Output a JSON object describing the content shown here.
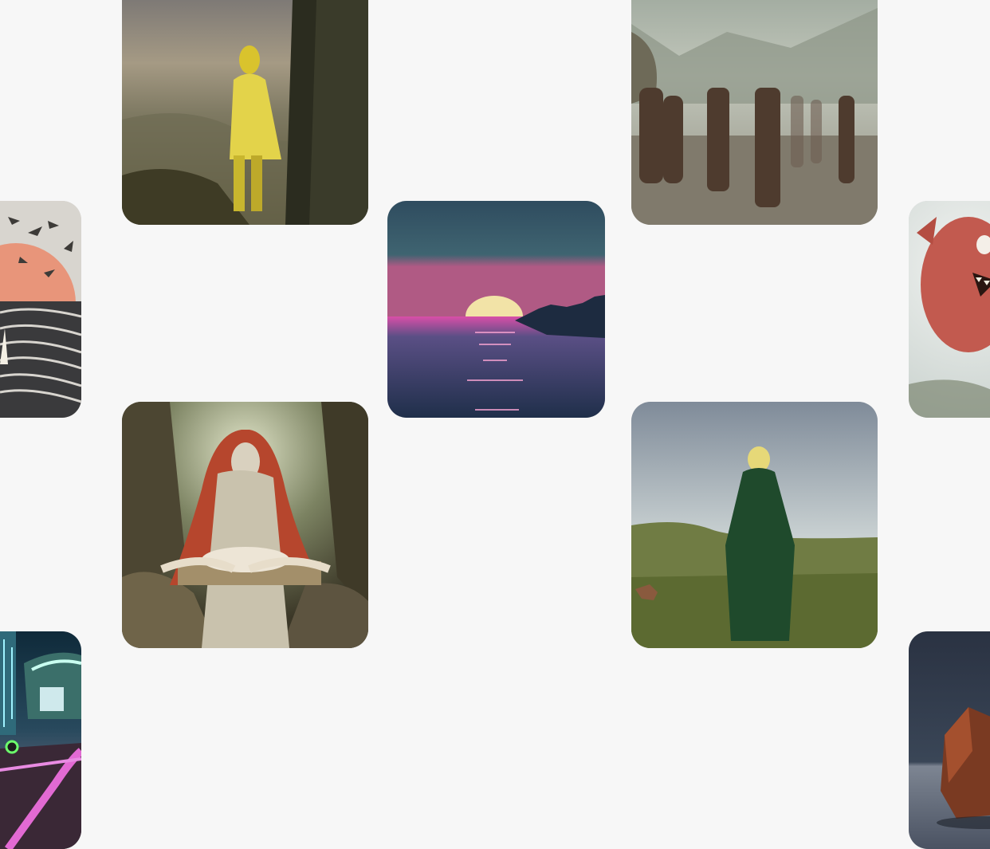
{
  "gallery": {
    "tiles": [
      {
        "id": "yellow-figure",
        "icon": "image-thumbnail"
      },
      {
        "id": "crowd-valley",
        "icon": "image-thumbnail"
      },
      {
        "id": "birds-sea",
        "icon": "image-thumbnail"
      },
      {
        "id": "synthwave-sunset",
        "icon": "image-thumbnail"
      },
      {
        "id": "fluffy-monster",
        "icon": "image-thumbnail"
      },
      {
        "id": "madonna-child",
        "icon": "image-thumbnail"
      },
      {
        "id": "green-cloak",
        "icon": "image-thumbnail"
      },
      {
        "id": "neon-road",
        "icon": "image-thumbnail"
      },
      {
        "id": "copper-teapot",
        "icon": "image-thumbnail"
      }
    ]
  },
  "colors": {
    "background": "#f7f7f7"
  }
}
